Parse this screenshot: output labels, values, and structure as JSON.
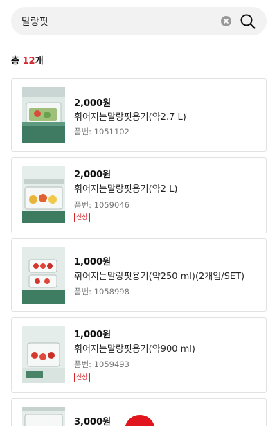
{
  "search": {
    "value": "말랑핏"
  },
  "result_count": {
    "prefix": "총 ",
    "number": "12",
    "suffix": "개"
  },
  "products": [
    {
      "price": "2,000원",
      "name": "휘어지는말랑핏용기(약2.7 L)",
      "artno": "품번: 1051102",
      "badge": ""
    },
    {
      "price": "2,000원",
      "name": "휘어지는말랑핏용기(약2 L)",
      "artno": "품번: 1059046",
      "badge": "신상"
    },
    {
      "price": "1,000원",
      "name": "휘어지는말랑핏용기(약250 ml)(2개입/SET)",
      "artno": "품번: 1058998",
      "badge": ""
    },
    {
      "price": "1,000원",
      "name": "휘어지는말랑핏용기(약900 ml)",
      "artno": "품번: 1059493",
      "badge": "신상"
    },
    {
      "price": "3,000원",
      "name": "",
      "artno": "",
      "badge": ""
    }
  ],
  "colors": {
    "accent": "#d4252b",
    "fab": "#e0151e",
    "card_border": "#e2e2e2",
    "search_bg": "#f2f2f2"
  },
  "icons": {
    "search": "search-icon",
    "clear": "clear-icon"
  }
}
